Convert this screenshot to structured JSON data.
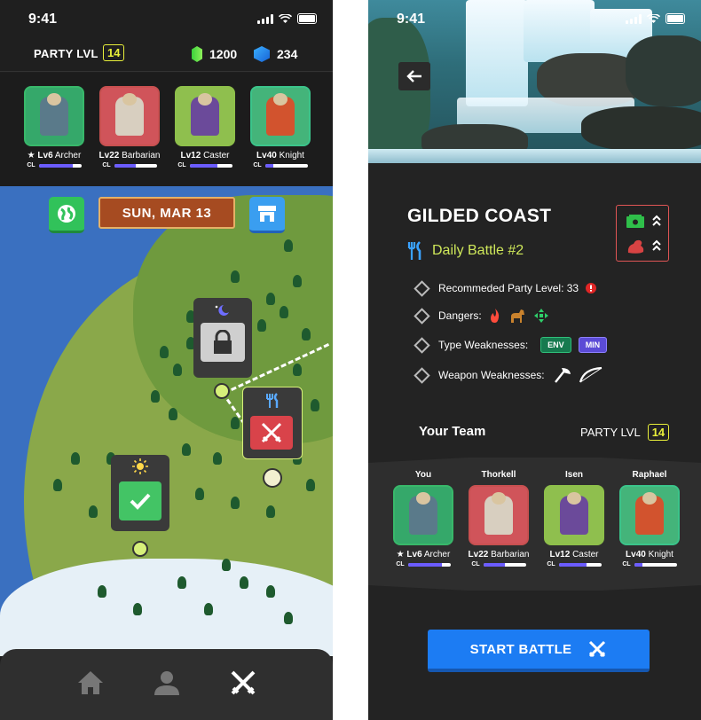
{
  "status_bar": {
    "time": "9:41"
  },
  "map_screen": {
    "party_level_label": "PARTY LVL",
    "party_level": "14",
    "currency": {
      "green_gems": "1200",
      "blue_gems": "234"
    },
    "party": [
      {
        "star": "★",
        "level": "Lv6",
        "class": "Archer",
        "cl_label": "CL",
        "cl_progress": 0.8,
        "frame_color": "#38b86a",
        "bg": "#35a86a",
        "body": "#5a7a8a"
      },
      {
        "star": "",
        "level": "Lv22",
        "class": "Barbarian",
        "cl_label": "CL",
        "cl_progress": 0.5,
        "frame_color": "#c85050",
        "bg": "#d0545a",
        "body": "#d8cfc0"
      },
      {
        "star": "",
        "level": "Lv12",
        "class": "Caster",
        "cl_label": "CL",
        "cl_progress": 0.65,
        "frame_color": "#8ec04a",
        "bg": "#8fbf4e",
        "body": "#6b4a9a"
      },
      {
        "star": "",
        "level": "Lv40",
        "class": "Knight",
        "cl_label": "CL",
        "cl_progress": 0.2,
        "frame_color": "#3bc48a",
        "bg": "#44b47a",
        "body": "#d2532e"
      }
    ],
    "date": "SUN, MAR 13",
    "nav": {
      "home": "home-icon",
      "profile": "person-icon",
      "battle": "crossed-swords-icon"
    }
  },
  "battle_screen": {
    "title": "GILDED COAST",
    "subtitle": "Daily Battle #2",
    "recommended_label": "Recommeded Party Level: 33",
    "dangers_label": "Dangers:",
    "type_weak_label": "Type Weaknesses:",
    "type_weak_tags": [
      "ENV",
      "MIN"
    ],
    "weapon_weak_label": "Weapon Weaknesses:",
    "team_heading": "Your Team",
    "party_level_label": "PARTY LVL",
    "party_level": "14",
    "team": [
      {
        "name": "You",
        "star": "★",
        "level": "Lv6",
        "class": "Archer",
        "cl_label": "CL",
        "cl_progress": 0.8,
        "frame_color": "#38b86a",
        "bg": "#35a86a",
        "body": "#5a7a8a"
      },
      {
        "name": "Thorkell",
        "star": "",
        "level": "Lv22",
        "class": "Barbarian",
        "cl_label": "CL",
        "cl_progress": 0.5,
        "frame_color": "#c85050",
        "bg": "#d0545a",
        "body": "#d8cfc0"
      },
      {
        "name": "Isen",
        "star": "",
        "level": "Lv12",
        "class": "Caster",
        "cl_label": "CL",
        "cl_progress": 0.65,
        "frame_color": "#8ec04a",
        "bg": "#8fbf4e",
        "body": "#6b4a9a"
      },
      {
        "name": "Raphael",
        "star": "",
        "level": "Lv40",
        "class": "Knight",
        "cl_label": "CL",
        "cl_progress": 0.2,
        "frame_color": "#3bc48a",
        "bg": "#44b47a",
        "body": "#d2532e"
      }
    ],
    "start_button": "START BATTLE"
  },
  "colors": {
    "accent_yellow": "#e8ef3a",
    "cl_bar": "#6b5cff",
    "start_blue": "#1c7cf3",
    "subtitle_green": "#cfe85a"
  }
}
